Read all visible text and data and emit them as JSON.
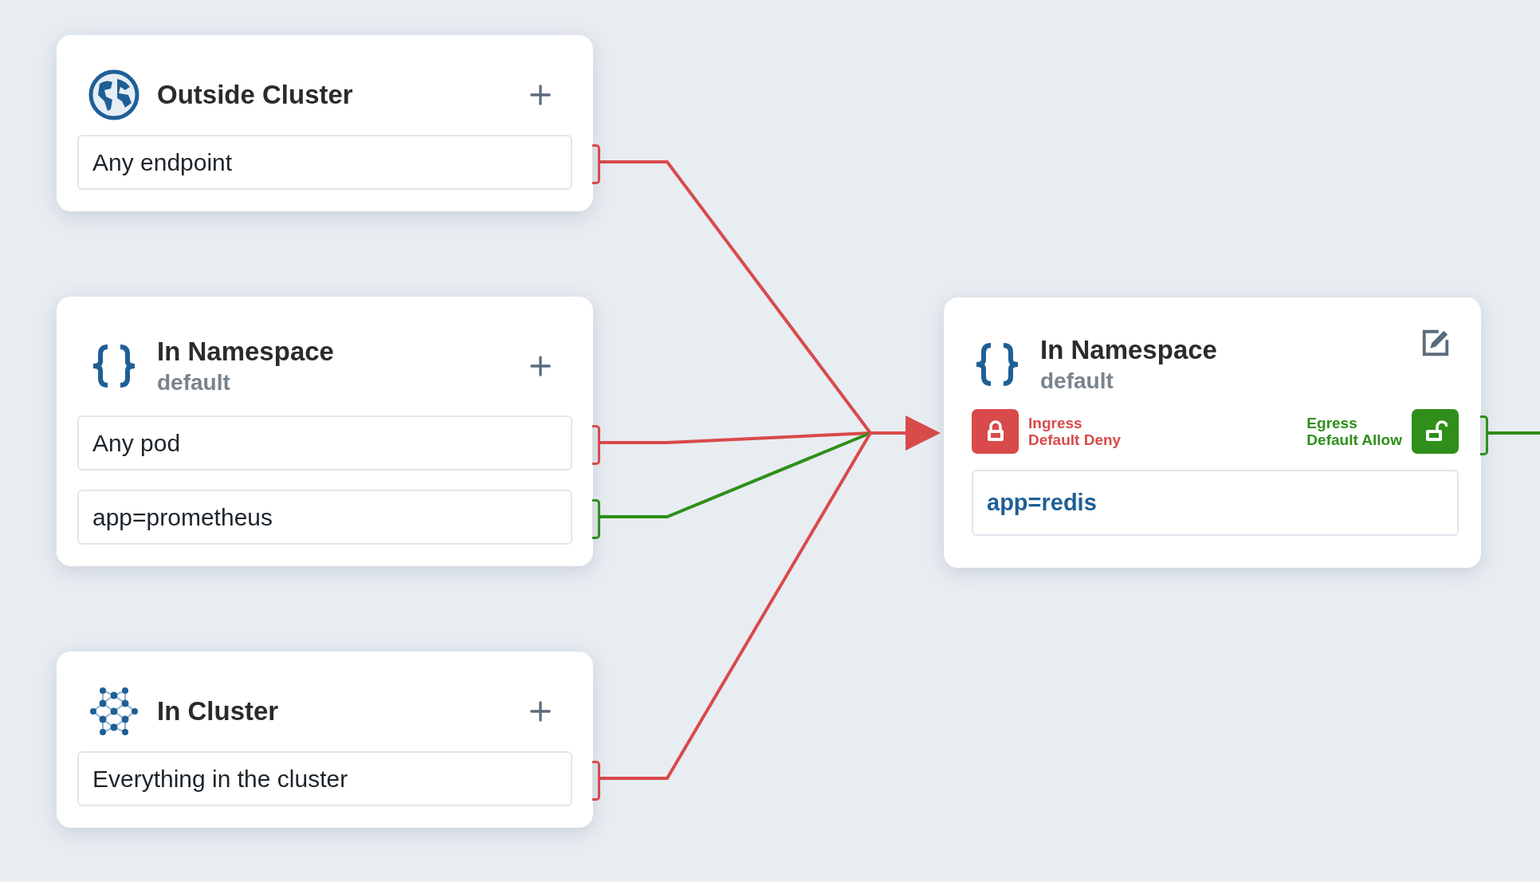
{
  "sources": [
    {
      "kind": "globe",
      "title": "Outside Cluster",
      "selectors": [
        {
          "label": "Any endpoint",
          "color": "#d94a4a"
        }
      ]
    },
    {
      "kind": "namespace",
      "title": "In Namespace",
      "subtitle": "default",
      "selectors": [
        {
          "label": "Any pod",
          "color": "#d94a4a"
        },
        {
          "label": "app=prometheus",
          "color": "#2f8f1a"
        }
      ]
    },
    {
      "kind": "cluster",
      "title": "In Cluster",
      "selectors": [
        {
          "label": "Everything in the cluster",
          "color": "#d94a4a"
        }
      ]
    }
  ],
  "target": {
    "kind": "namespace",
    "title": "In Namespace",
    "subtitle": "default",
    "ingress": {
      "title": "Ingress",
      "policy": "Default Deny",
      "locked": true
    },
    "egress": {
      "title": "Egress",
      "policy": "Default Allow",
      "locked": false
    },
    "selector": "app=redis"
  }
}
